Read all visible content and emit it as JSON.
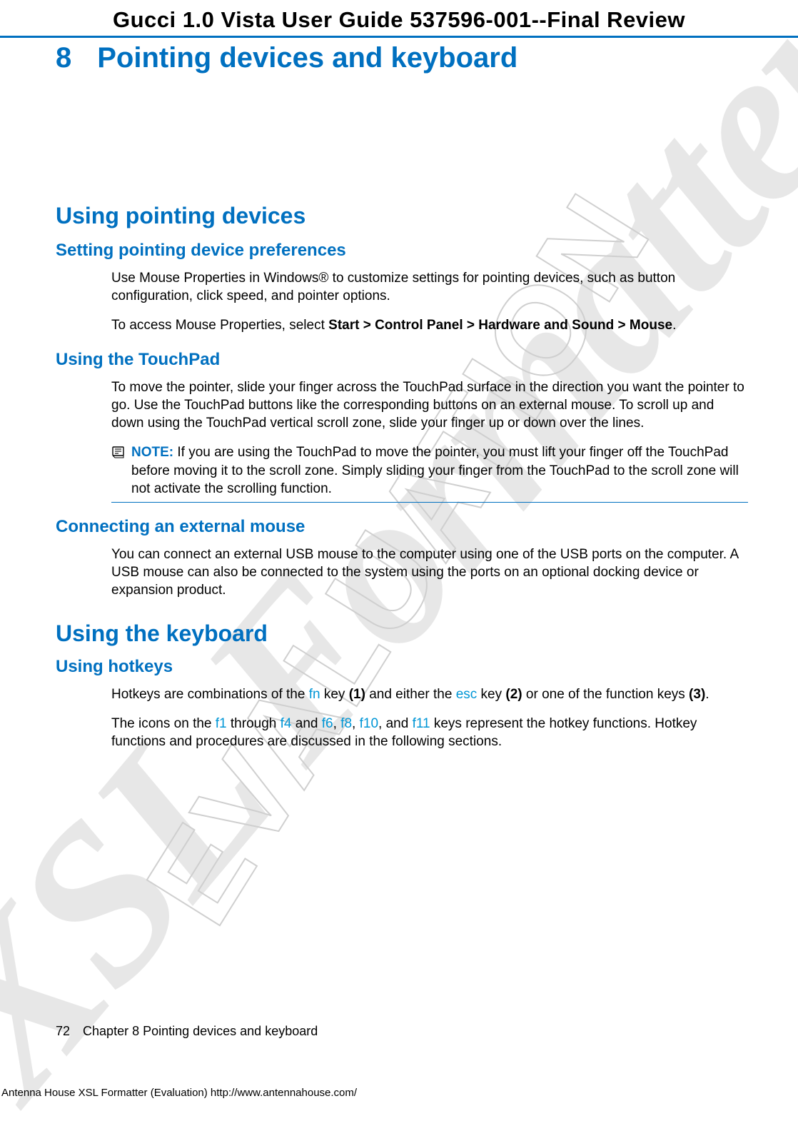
{
  "watermarks": {
    "xsl": "XSL Formatter",
    "eval": "EVALUATION"
  },
  "header": {
    "doc_title": "Gucci 1.0 Vista User Guide 537596-001--Final Review"
  },
  "chapter": {
    "number": "8",
    "title": "Pointing devices and keyboard"
  },
  "sections": {
    "using_pointing_devices": "Using pointing devices",
    "setting_prefs": {
      "title": "Setting pointing device preferences",
      "p1": "Use Mouse Properties in Windows® to customize settings for pointing devices, such as button configuration, click speed, and pointer options.",
      "p2_pre": "To access Mouse Properties, select ",
      "p2_bold": "Start > Control Panel > Hardware and Sound > Mouse",
      "p2_post": "."
    },
    "using_touchpad": {
      "title": "Using the TouchPad",
      "p1": "To move the pointer, slide your finger across the TouchPad surface in the direction you want the pointer to go. Use the TouchPad buttons like the corresponding buttons on an external mouse. To scroll up and down using the TouchPad vertical scroll zone, slide your finger up or down over the lines.",
      "note_label": "NOTE:",
      "note_text": "If you are using the TouchPad to move the pointer, you must lift your finger off the TouchPad before moving it to the scroll zone. Simply sliding your finger from the TouchPad to the scroll zone will not activate the scrolling function."
    },
    "external_mouse": {
      "title": "Connecting an external mouse",
      "p1": "You can connect an external USB mouse to the computer using one of the USB ports on the computer. A USB mouse can also be connected to the system using the ports on an optional docking device or expansion product."
    },
    "using_keyboard": "Using the keyboard",
    "using_hotkeys": {
      "title": "Using hotkeys",
      "p1_segments": {
        "a": "Hotkeys are combinations of the ",
        "fn": "fn",
        "b": " key ",
        "b1": "(1)",
        "c": " and either the ",
        "esc": "esc",
        "d": " key ",
        "d1": "(2)",
        "e": " or one of the function keys ",
        "e1": "(3)",
        "f": "."
      },
      "p2_segments": {
        "a": "The icons on the ",
        "f1": "f1",
        "b": " through ",
        "f4": "f4",
        "c": " and ",
        "f6": "f6",
        "d": ", ",
        "f8": "f8",
        "e": ", ",
        "f10": "f10",
        "f": ", and ",
        "f11": "f11",
        "g": " keys represent the hotkey functions. Hotkey functions and procedures are discussed in the following sections."
      }
    }
  },
  "footer": {
    "page_number": "72",
    "breadcrumb": "Chapter 8   Pointing devices and keyboard",
    "generator": "Antenna House XSL Formatter (Evaluation)  http://www.antennahouse.com/"
  }
}
